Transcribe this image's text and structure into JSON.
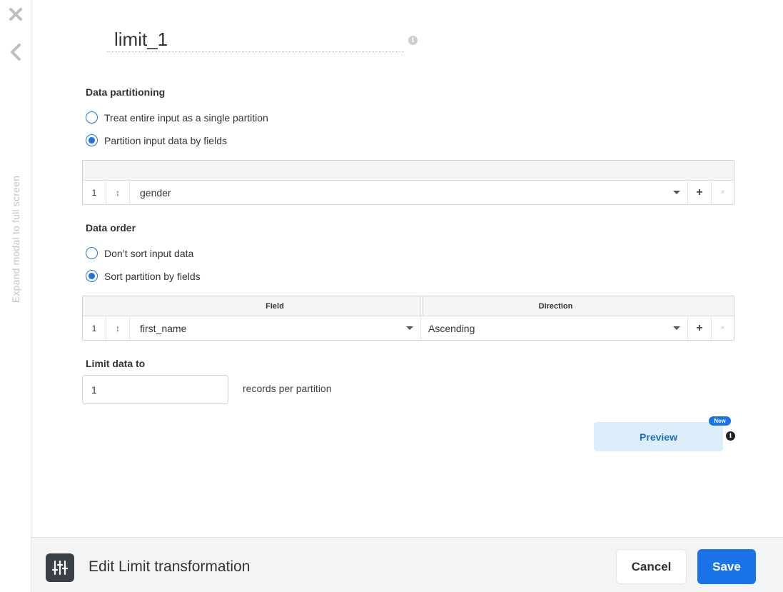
{
  "rail": {
    "close_icon": "close-icon",
    "collapse_icon": "chevron-left-icon",
    "expand_label": "Expand modal to full screen"
  },
  "header": {
    "title": "limit_1",
    "info_glyph": "i"
  },
  "partitioning": {
    "label": "Data partitioning",
    "options": [
      {
        "label": "Treat entire input as a single partition",
        "checked": false
      },
      {
        "label": "Partition input data by fields",
        "checked": true
      }
    ],
    "rows": [
      {
        "index": "1",
        "drag": "↕",
        "field": "gender",
        "add": "+",
        "remove": "×"
      }
    ]
  },
  "order": {
    "label": "Data order",
    "options": [
      {
        "label": "Don’t sort input data",
        "checked": false
      },
      {
        "label": "Sort partition by fields",
        "checked": true
      }
    ],
    "columns": [
      "Field",
      "Direction"
    ],
    "rows": [
      {
        "index": "1",
        "drag": "↕",
        "field": "first_name",
        "direction": "Ascending",
        "add": "+",
        "remove": "×"
      }
    ]
  },
  "limit": {
    "label": "Limit data to",
    "value": "1",
    "suffix": "records per partition"
  },
  "preview": {
    "label": "Preview",
    "badge": "New",
    "info_glyph": "i"
  },
  "footer": {
    "icon": "sliders-icon",
    "title": "Edit Limit transformation",
    "cancel_label": "Cancel",
    "save_label": "Save"
  },
  "colors": {
    "accent": "#1a73e8",
    "preview_bg": "#dceefa",
    "footer_bg": "#f3f4f6",
    "footer_icon_bg": "#3a4048"
  }
}
